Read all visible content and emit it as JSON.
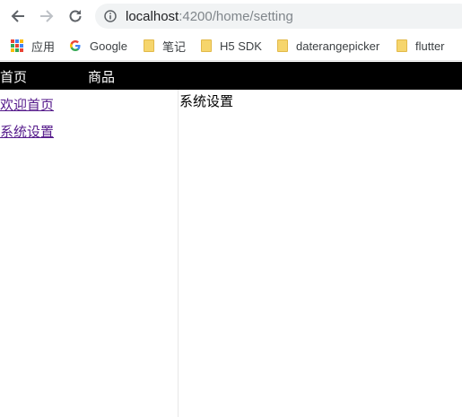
{
  "browser": {
    "url_host": "localhost",
    "url_path": ":4200/home/setting",
    "icons": {
      "back": "arrow-left-icon",
      "forward": "arrow-right-icon",
      "reload": "reload-icon",
      "info": "info-icon"
    }
  },
  "bookmarks": [
    {
      "label": "应用",
      "icon": "apps-grid-icon"
    },
    {
      "label": "Google",
      "icon": "google-icon"
    },
    {
      "label": "笔记",
      "icon": "folder-icon"
    },
    {
      "label": "H5 SDK",
      "icon": "folder-icon"
    },
    {
      "label": "daterangepicker",
      "icon": "folder-icon"
    },
    {
      "label": "flutter",
      "icon": "folder-icon"
    }
  ],
  "app": {
    "topnav": [
      "首页",
      "商品"
    ],
    "sidebar": [
      "欢迎首页",
      "系统设置"
    ],
    "content_title": "系统设置"
  },
  "colors": {
    "nav_bar": "#000000",
    "visited_link": "#551a8b",
    "omnibox_bg": "#f1f3f4"
  }
}
